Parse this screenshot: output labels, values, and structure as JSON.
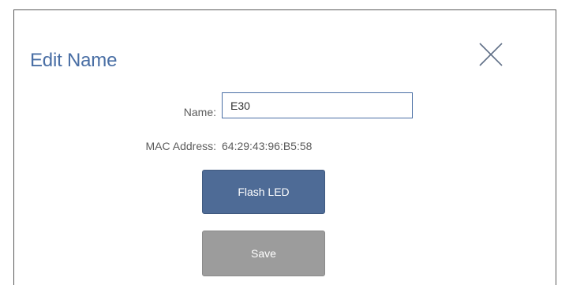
{
  "dialog": {
    "title": "Edit Name",
    "close_icon": "close-icon",
    "name_label": "Name:",
    "name_value": "E30",
    "mac_label": "MAC Address:",
    "mac_value": "64:29:43:96:B5:58",
    "flash_button_label": "Flash LED",
    "save_button_label": "Save"
  },
  "colors": {
    "title": "#4a6fa5",
    "input_border": "#4a6fa5",
    "flash_button": "#4e6b96",
    "save_button": "#9c9c9c",
    "label_text": "#5b5b5b"
  }
}
